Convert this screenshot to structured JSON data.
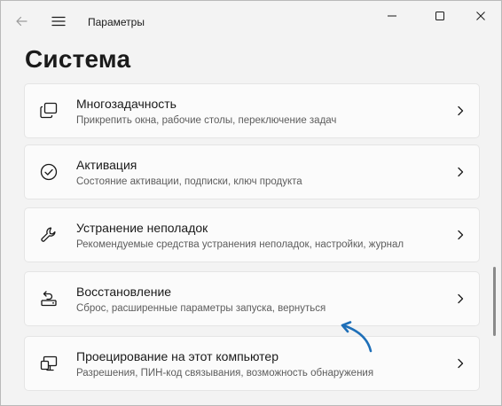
{
  "window": {
    "title": "Параметры",
    "back_icon": "arrow-left-icon",
    "menu_icon": "hamburger-icon",
    "minimize_icon": "minimize-icon",
    "maximize_icon": "maximize-icon",
    "close_icon": "close-icon"
  },
  "page": {
    "title": "Система"
  },
  "items": [
    {
      "title": "Многозадачность",
      "description": "Прикрепить окна, рабочие столы, переключение задач",
      "icon": "multitasking-icon"
    },
    {
      "title": "Активация",
      "description": "Состояние активации, подписки, ключ продукта",
      "icon": "check-circle-icon"
    },
    {
      "title": "Устранение неполадок",
      "description": "Рекомендуемые средства устранения неполадок, настройки, журнал",
      "icon": "wrench-icon"
    },
    {
      "title": "Восстановление",
      "description": "Сброс, расширенные параметры запуска, вернуться",
      "icon": "recovery-icon"
    },
    {
      "title": "Проецирование на этот компьютер",
      "description": "Разрешения, ПИН-код связывания, возможность обнаружения",
      "icon": "projection-icon"
    }
  ],
  "colors": {
    "background": "#f3f3f3",
    "card": "#fbfbfb",
    "annotation_arrow": "#1e6fb8"
  }
}
